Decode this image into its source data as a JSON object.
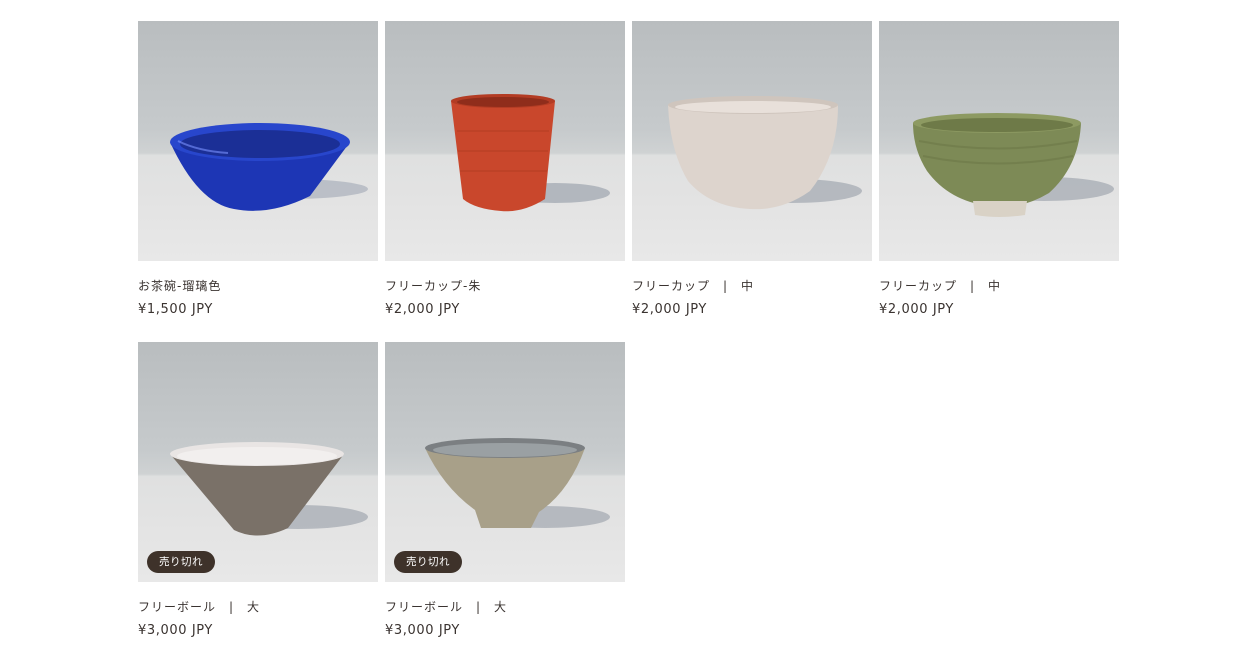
{
  "products": [
    {
      "title": "お茶碗-瑠璃色",
      "price": "¥1,500 JPY",
      "sold_out": false,
      "image": "ruri-blue-chawan"
    },
    {
      "title": "フリーカップ-朱",
      "price": "¥2,000 JPY",
      "sold_out": false,
      "image": "vermilion-cup"
    },
    {
      "title": "フリーカップ　|　中",
      "price": "¥2,000 JPY",
      "sold_out": false,
      "image": "white-bowl"
    },
    {
      "title": "フリーカップ　|　中",
      "price": "¥2,000 JPY",
      "sold_out": false,
      "image": "green-bowl"
    },
    {
      "title": "フリーボール　|　大",
      "price": "¥3,000 JPY",
      "sold_out": true,
      "badge": "売り切れ",
      "image": "grey-conical-bowl"
    },
    {
      "title": "フリーボール　|　大",
      "price": "¥3,000 JPY",
      "sold_out": true,
      "badge": "売り切れ",
      "image": "silver-bowl"
    }
  ],
  "colors": {
    "text": "#3a3330",
    "badge_bg": "#3e322a",
    "badge_text": "#ffffff"
  }
}
